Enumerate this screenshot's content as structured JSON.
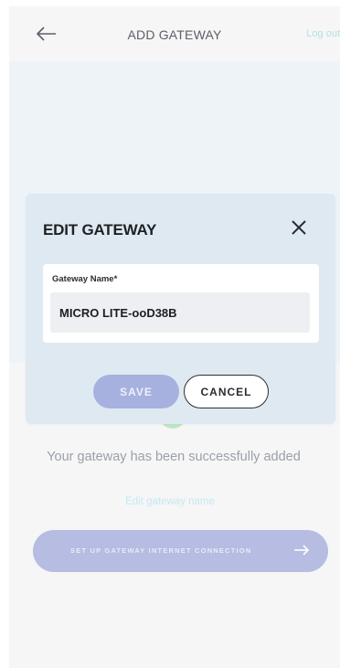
{
  "header": {
    "title": "ADD GATEWAY",
    "logout_label": "Log out",
    "back_icon": "arrow-left-icon"
  },
  "background": {
    "success_message": "Your gateway has been successfully added",
    "edit_link": "Edit gateway name",
    "setup_button": "SET UP GATEWAY INTERNET CONNECTION",
    "setup_icon": "arrow-right-icon"
  },
  "modal": {
    "title": "EDIT GATEWAY",
    "close_icon": "close-icon",
    "field_label": "Gateway Name*",
    "field_value": "MICRO LITE-ooD38B",
    "save_label": "SAVE",
    "cancel_label": "CANCEL"
  },
  "colors": {
    "accent": "#a6b1e0",
    "modal_bg": "#dfe9f1",
    "success": "#bfe8c5",
    "link": "#c6e8ef"
  }
}
